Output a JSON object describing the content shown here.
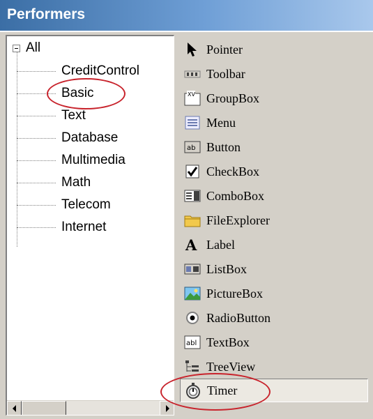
{
  "window": {
    "title": "Performers"
  },
  "tree": {
    "root": {
      "label": "All"
    },
    "items": [
      {
        "label": "CreditControl"
      },
      {
        "label": "Basic"
      },
      {
        "label": "Text"
      },
      {
        "label": "Database"
      },
      {
        "label": "Multimedia"
      },
      {
        "label": "Math"
      },
      {
        "label": "Telecom"
      },
      {
        "label": "Internet"
      }
    ]
  },
  "toolbox": {
    "items": [
      {
        "label": "Pointer",
        "icon": "pointer-icon"
      },
      {
        "label": "Toolbar",
        "icon": "toolbar-icon"
      },
      {
        "label": "GroupBox",
        "icon": "groupbox-icon"
      },
      {
        "label": "Menu",
        "icon": "menu-icon"
      },
      {
        "label": "Button",
        "icon": "button-icon"
      },
      {
        "label": "CheckBox",
        "icon": "checkbox-icon"
      },
      {
        "label": "ComboBox",
        "icon": "combobox-icon"
      },
      {
        "label": "FileExplorer",
        "icon": "folder-icon"
      },
      {
        "label": "Label",
        "icon": "label-icon"
      },
      {
        "label": "ListBox",
        "icon": "listbox-icon"
      },
      {
        "label": "PictureBox",
        "icon": "picture-icon"
      },
      {
        "label": "RadioButton",
        "icon": "radio-icon"
      },
      {
        "label": "TextBox",
        "icon": "textbox-icon"
      },
      {
        "label": "TreeView",
        "icon": "treeview-icon"
      },
      {
        "label": "Timer",
        "icon": "timer-icon"
      }
    ]
  },
  "annotations": {
    "highlight_color": "#c8232c"
  },
  "colors": {
    "title_bar_start": "#3b6ea5",
    "panel_bg": "#d4d0c8"
  }
}
